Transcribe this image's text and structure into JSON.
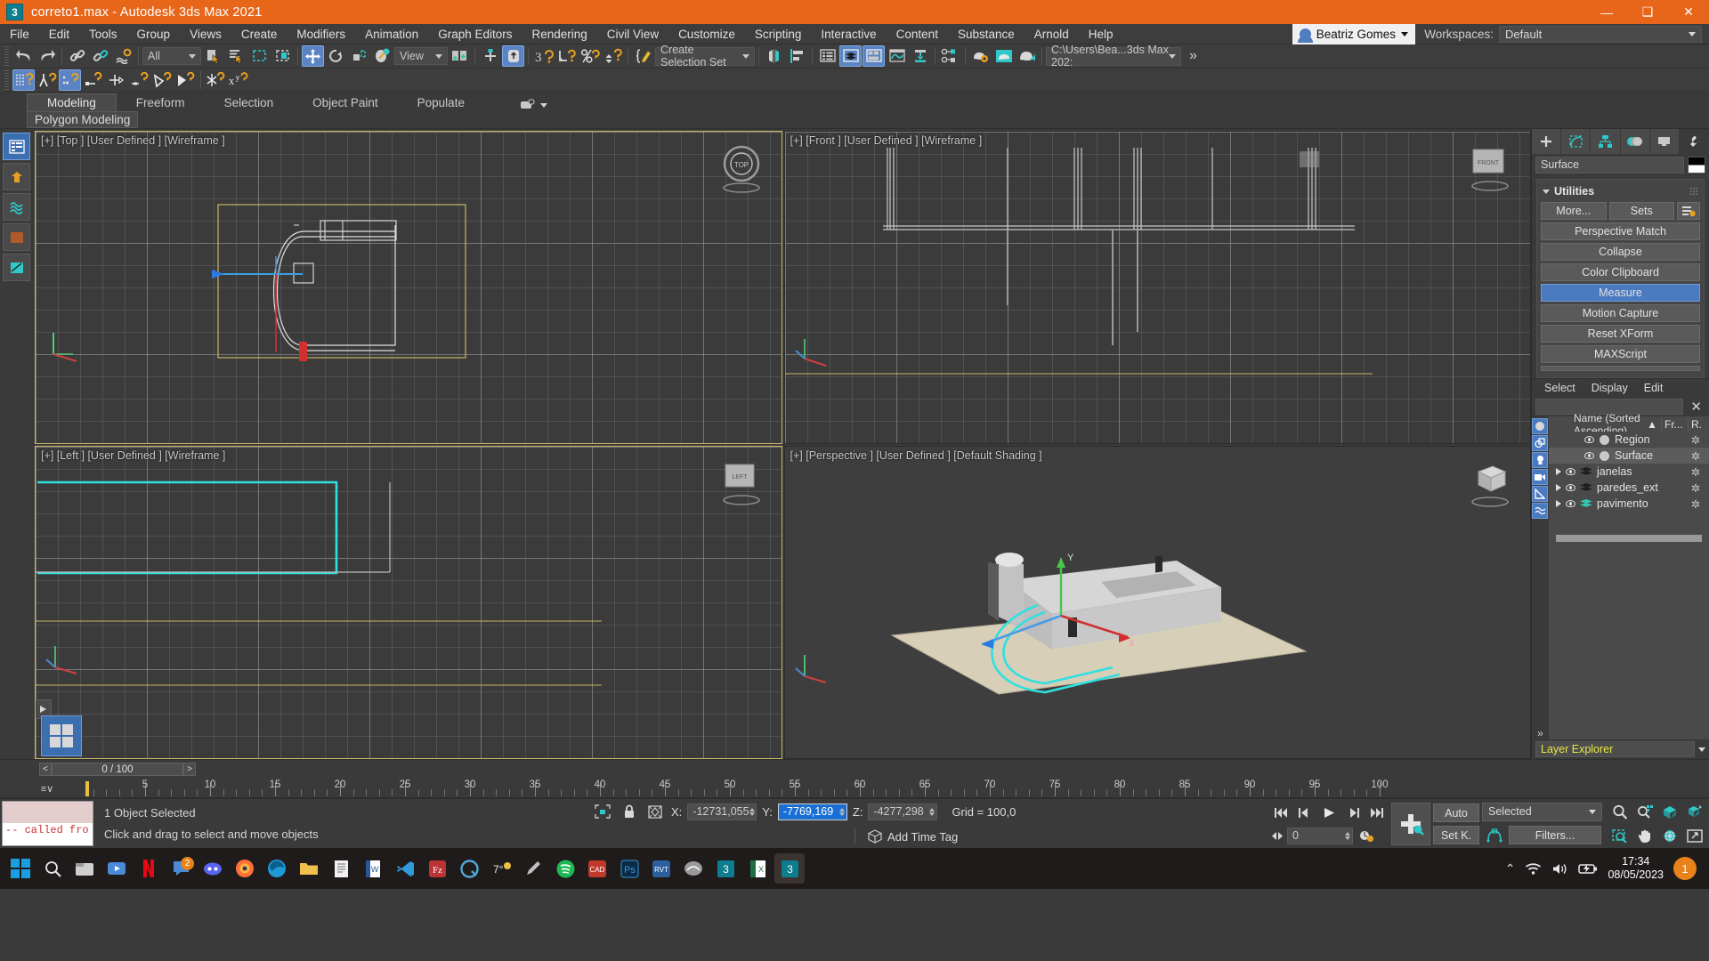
{
  "window": {
    "title": "correto1.max - Autodesk 3ds Max 2021",
    "app_icon": "3ds-max-icon",
    "minimize": "—",
    "maximize": "❑",
    "close": "✕"
  },
  "menu": {
    "items": [
      {
        "label": "File"
      },
      {
        "label": "Edit"
      },
      {
        "label": "Tools"
      },
      {
        "label": "Group"
      },
      {
        "label": "Views"
      },
      {
        "label": "Create"
      },
      {
        "label": "Modifiers"
      },
      {
        "label": "Animation"
      },
      {
        "label": "Graph Editors"
      },
      {
        "label": "Rendering"
      },
      {
        "label": "Civil View"
      },
      {
        "label": "Customize"
      },
      {
        "label": "Scripting"
      },
      {
        "label": "Interactive"
      },
      {
        "label": "Content"
      },
      {
        "label": "Substance"
      },
      {
        "label": "Arnold"
      },
      {
        "label": "Help"
      }
    ],
    "user_name": "Beatriz Gomes",
    "workspaces_label": "Workspaces:",
    "workspace_value": "Default"
  },
  "toolbar": {
    "selection_filter": "All",
    "reference_coord": "View",
    "selection_set": "Create Selection Set",
    "project_path": "C:\\Users\\Bea...3ds Max 202:",
    "overflow": "»"
  },
  "ribbon": {
    "tabs": [
      {
        "label": "Modeling",
        "active": true
      },
      {
        "label": "Freeform",
        "active": false
      },
      {
        "label": "Selection",
        "active": false
      },
      {
        "label": "Object Paint",
        "active": false
      },
      {
        "label": "Populate",
        "active": false
      }
    ],
    "subtab": "Polygon Modeling"
  },
  "viewports": [
    {
      "label": "[+] [Top ] [User Defined ] [Wireframe ]",
      "name": "viewport-top",
      "active": true
    },
    {
      "label": "[+] [Front ] [User Defined ] [Wireframe ]",
      "name": "viewport-front",
      "active": false
    },
    {
      "label": "[+] [Left ] [User Defined ] [Wireframe ]",
      "name": "viewport-left",
      "active": false
    },
    {
      "label": "[+] [Perspective ] [User Defined ] [Default Shading ]",
      "name": "viewport-perspective",
      "active": false
    }
  ],
  "command_panel": {
    "tabs": [
      "create-tab",
      "modify-tab",
      "hierarchy-tab",
      "motion-tab",
      "display-tab",
      "utilities-tab"
    ],
    "object_name": "Surface",
    "rollout_title": "Utilities",
    "buttons_row": [
      "More...",
      "Sets"
    ],
    "buttons": [
      "Perspective Match",
      "Collapse",
      "Color Clipboard",
      "Measure",
      "Motion Capture",
      "Reset XForm",
      "MAXScript"
    ],
    "active_button": "Measure"
  },
  "scene_explorer": {
    "menu": [
      "Select",
      "Display",
      "Edit"
    ],
    "search_value": "",
    "columns": [
      "Name (Sorted Ascending)",
      "Fr...",
      "R."
    ],
    "sort_arrow": "▲",
    "clear_icon": "✕",
    "rows": [
      {
        "name": "Region",
        "type": "object",
        "indent": 2,
        "selected": false,
        "expandable": false
      },
      {
        "name": "Surface",
        "type": "object",
        "indent": 2,
        "selected": true,
        "expandable": false
      },
      {
        "name": "janelas",
        "type": "layer",
        "indent": 0,
        "selected": false,
        "expandable": true
      },
      {
        "name": "paredes_ext",
        "type": "layer",
        "indent": 0,
        "selected": false,
        "expandable": true
      },
      {
        "name": "pavimento",
        "type": "layer-green",
        "indent": 0,
        "selected": false,
        "expandable": true
      }
    ],
    "footer_dropdown": "Layer Explorer"
  },
  "timeline": {
    "frame_range": "0 / 100",
    "prev_arrow": "<",
    "next_arrow": ">",
    "ticks": [
      5,
      10,
      15,
      20,
      25,
      30,
      35,
      40,
      45,
      50,
      55,
      60,
      65,
      70,
      75,
      80,
      85,
      90,
      95,
      100
    ]
  },
  "status_bar": {
    "listener_text": "--   called fro",
    "selection_status": "1 Object Selected",
    "prompt": "Click and drag to select and move objects",
    "x_label": "X:",
    "x_value": "-12731,055",
    "y_label": "Y:",
    "y_value": "-7769,169",
    "z_label": "Z:",
    "z_value": "-4277,298",
    "grid_text": "Grid = 100,0",
    "add_time_tag": "Add Time Tag",
    "current_frame": "0",
    "auto_key": "Auto",
    "set_key": "Set K.",
    "key_filter": "Selected",
    "filters": "Filters..."
  },
  "taskbar": {
    "items": [
      {
        "name": "start-windows-icon",
        "glyph": "⊞",
        "color": "#00a4ef"
      },
      {
        "name": "search-icon",
        "glyph": "⌕",
        "color": "#ffffff"
      },
      {
        "name": "file-explorer-icon",
        "glyph": "▤",
        "color": "#f6c344"
      },
      {
        "name": "video-player-icon",
        "glyph": "▶",
        "color": "#6cb5e8"
      },
      {
        "name": "netflix-icon",
        "glyph": "N",
        "color": "#e50914"
      },
      {
        "name": "chat-icon",
        "glyph": "✉",
        "color": "#5b8def"
      },
      {
        "name": "discord-icon",
        "glyph": "◔",
        "color": "#5865f2"
      },
      {
        "name": "firefox-icon",
        "glyph": "◉",
        "color": "#ff7139"
      },
      {
        "name": "edge-icon",
        "glyph": "◎",
        "color": "#2db8f0"
      },
      {
        "name": "folder-icon",
        "glyph": "▰",
        "color": "#f6c344"
      },
      {
        "name": "notepad-icon",
        "glyph": "▧",
        "color": "#e8e8e8"
      },
      {
        "name": "word-icon",
        "glyph": "W",
        "color": "#2b579a"
      },
      {
        "name": "vscode-icon",
        "glyph": "⬢",
        "color": "#2f9bdb"
      },
      {
        "name": "filezilla-icon",
        "glyph": "Fz",
        "color": "#bf2e2e"
      },
      {
        "name": "qbittorrent-icon",
        "glyph": "Q",
        "color": "#4fa8d8"
      },
      {
        "name": "weather-icon",
        "glyph": "7°",
        "color": "#e8e8e8"
      },
      {
        "name": "sketch-icon",
        "glyph": "✎",
        "color": "#c0c0c0"
      },
      {
        "name": "spotify-icon",
        "glyph": "●",
        "color": "#1db954"
      },
      {
        "name": "autocad-icon",
        "glyph": "CAD",
        "color": "#c0392b"
      },
      {
        "name": "photoshop-icon",
        "glyph": "◧",
        "color": "#0a5fa8"
      },
      {
        "name": "revit-icon",
        "glyph": "RVT",
        "color": "#2b5f9e"
      },
      {
        "name": "rhino-icon",
        "glyph": "◑",
        "color": "#8a8a8a"
      },
      {
        "name": "3dsmax-taskbar-icon",
        "glyph": "3",
        "color": "#0d7d8f"
      },
      {
        "name": "excel-icon",
        "glyph": "X",
        "color": "#1d6f42"
      },
      {
        "name": "3dsmax-active-icon",
        "glyph": "3",
        "color": "#0d7d8f"
      }
    ],
    "chat_badge": "2",
    "tray": {
      "chevron": "⌃",
      "wifi": "wifi-icon",
      "volume": "volume-icon",
      "battery": "battery-icon",
      "time": "17:34",
      "date": "08/05/2023",
      "notification_count": "1"
    }
  },
  "colors": {
    "brand_orange": "#e8661a",
    "accent_blue": "#4a7ac0",
    "teal": "#30c8c8",
    "active_vp_border": "#c8b464"
  }
}
